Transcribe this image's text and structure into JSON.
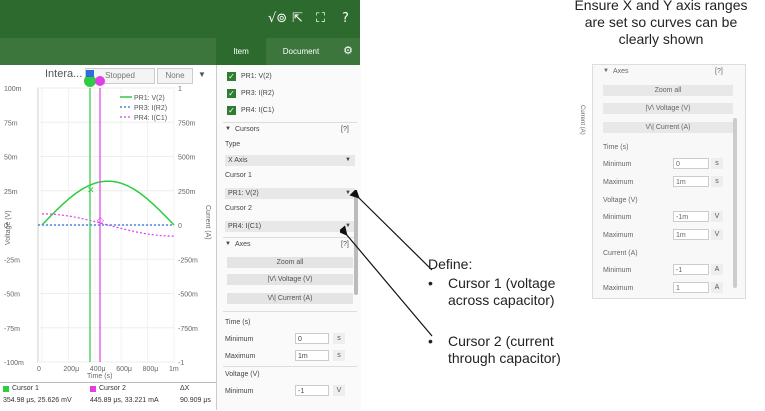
{
  "toolbar": {
    "icons": [
      "wave-icon",
      "export-icon",
      "fullscreen-icon",
      "help-icon"
    ],
    "help_label": "?"
  },
  "plot": {
    "title": "Intera...",
    "status": "Stopped",
    "dropdown": "None",
    "left_ticks": [
      "100m",
      "75m",
      "50m",
      "25m",
      "0",
      "-25m",
      "-50m",
      "-75m",
      "-100m"
    ],
    "right_ticks": [
      "1",
      "750m",
      "500m",
      "250m",
      "0",
      "-250m",
      "-500m",
      "-750m",
      "-1"
    ],
    "x_ticks": [
      "0",
      "200μ",
      "400μ",
      "600μ",
      "800μ",
      "1m"
    ],
    "ylabel_left": "Voltage (V)",
    "ylabel_right": "Current (A)",
    "xlabel": "Time (s)",
    "legend": [
      "PR1: V(2)",
      "PR3: I(R2)",
      "PR4: I(C1)"
    ],
    "colors": {
      "v2": "#2ecc40",
      "ir2": "#2e6bdc",
      "ic1": "#e23ee6",
      "cursor1": "#2ecc40",
      "cursor2": "#e23ee6"
    }
  },
  "cursor_table": {
    "headers": [
      "Cursor 1",
      "Cursor 2",
      "ΔX"
    ],
    "values": [
      "354.98 μs, 25.626 mV",
      "445.89 μs, 33.221 mA",
      "90.909 μs"
    ]
  },
  "panel": {
    "tabs": [
      "Item",
      "Document"
    ],
    "probes": [
      "PR1: V(2)",
      "PR3: I(R2)",
      "PR4: I(C1)"
    ],
    "cursors_header": "Cursors",
    "help": "[?]",
    "type_label": "Type",
    "type_value": "X Axis",
    "cursor1_label": "Cursor 1",
    "cursor1_value": "PR1: V(2)",
    "cursor2_label": "Cursor 2",
    "cursor2_value": "PR4: I(C1)",
    "axes_header": "Axes",
    "zoom_all": "Zoom all",
    "voltage_btn": "|V\\  Voltage (V)",
    "current_btn": "V\\|  Current (A)",
    "time_label": "Time (s)",
    "minimum": "Minimum",
    "maximum": "Maximum",
    "time_min": "0",
    "time_max": "1m",
    "time_unit": "s",
    "voltage_label": "Voltage (V)",
    "volt_min": "-1",
    "volt_unit": "V"
  },
  "annotations": {
    "top_note": "Ensure X and Y axis ranges are set so curves can be clearly shown",
    "define": "Define:",
    "bullet1": "Cursor 1 (voltage across capacitor)",
    "bullet2": "Cursor 2 (current through capacitor)"
  },
  "inset": {
    "axes_header": "Axes",
    "help": "[?]",
    "zoom_all": "Zoom all",
    "voltage_btn": "|V\\  Voltage (V)",
    "current_btn": "V\\|  Current (A)",
    "side_label": "Current (A)",
    "time_label": "Time (s)",
    "time_min": "0",
    "time_max": "1m",
    "time_unit": "s",
    "voltage_label": "Voltage (V)",
    "volt_min": "-1m",
    "volt_max": "1m",
    "volt_unit": "V",
    "current_label": "Current (A)",
    "cur_min": "-1",
    "cur_max": "1",
    "cur_unit": "A",
    "minimum": "Minimum",
    "maximum": "Maximum"
  }
}
